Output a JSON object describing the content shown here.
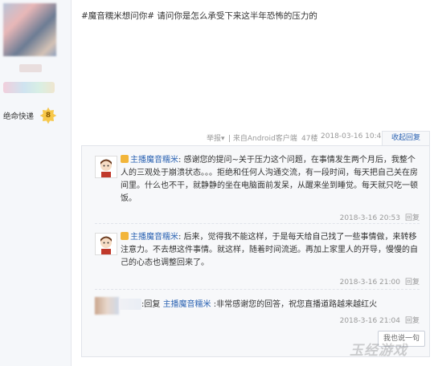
{
  "sidebar": {
    "level_title": "绝命快递",
    "level_num": "8"
  },
  "post": {
    "title": "#魔音糯米想问你# 请问你是怎么承受下来这半年恐怖的压力的",
    "report": "举报",
    "client": "| 来自Android客户端",
    "floor": "47楼",
    "time": "2018-03-16 10:41",
    "collapse": "收起回复"
  },
  "replies": [
    {
      "user": "主播魔音糯米",
      "text": ": 感谢您的提问~关于压力这个问题，在事情发生两个月后，我整个人的三观处于崩溃状态。。。拒绝和任何人沟通交流，有一段时间，每天把自己关在房间里。什么也不干，就静静的坐在电脑面前发呆，从醒来坐到睡觉。每天就只吃一顿饭。",
      "time": "2018-3-16 20:53",
      "reply_label": "回复"
    },
    {
      "user": "主播魔音糯米",
      "text": ": 后来，觉得我不能这样，于是每天给自己找了一些事情做，来转移注意力。不去想这件事情。就这样，随着时间流逝。再加上家里人的开导，慢慢的自己的心态也调整回来了。",
      "time": "2018-3-16 21:00",
      "reply_label": "回复"
    },
    {
      "prefix": ":回复 ",
      "user": "主播魔音糯米",
      "text": " :非常感谢您的回答，祝您直播道路越来越红火",
      "time": "2018-3-16 21:04",
      "reply_label": "回复"
    }
  ],
  "say_button": "我也说一句",
  "watermark": "玉经游戏"
}
